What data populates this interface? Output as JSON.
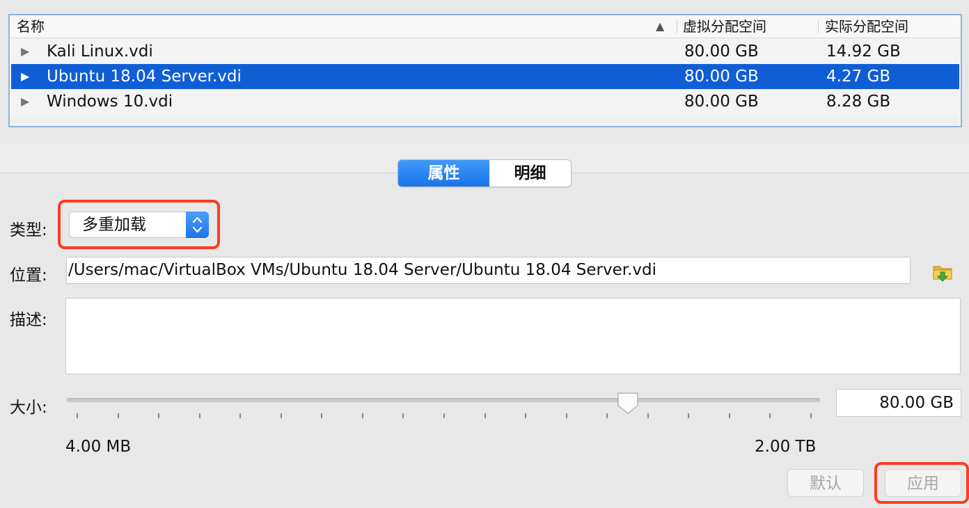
{
  "table": {
    "columns": {
      "name": "名称",
      "virtual": "虚拟分配空间",
      "actual": "实际分配空间"
    },
    "sort_indicator": "▲",
    "rows": [
      {
        "name": "Kali Linux.vdi",
        "virtual": "80.00 GB",
        "actual": "14.92 GB",
        "selected": false
      },
      {
        "name": "Ubuntu 18.04 Server.vdi",
        "virtual": "80.00 GB",
        "actual": "4.27 GB",
        "selected": true
      },
      {
        "name": "Windows 10.vdi",
        "virtual": "80.00 GB",
        "actual": "8.28 GB",
        "selected": false
      }
    ],
    "expand_icon": "disclosure-triangle-icon"
  },
  "tabs": {
    "properties": "属性",
    "details": "明细",
    "active": "properties"
  },
  "form": {
    "type_label": "类型:",
    "type_value": "多重加载",
    "location_label": "位置:",
    "location_value": "/Users/mac/VirtualBox VMs/Ubuntu 18.04 Server/Ubuntu 18.04 Server.vdi",
    "description_label": "描述:",
    "description_value": "",
    "size_label": "大小:",
    "size_value": "80.00 GB",
    "size_min": "4.00 MB",
    "size_max": "2.00 TB",
    "size_slider_fraction": 0.745,
    "folder_icon": "folder-open-icon"
  },
  "buttons": {
    "reset": "默认",
    "apply": "应用"
  },
  "colors": {
    "selection": "#0f5ed6",
    "accent": "#1a73ea",
    "highlight_annotation": "#ff3b22"
  }
}
